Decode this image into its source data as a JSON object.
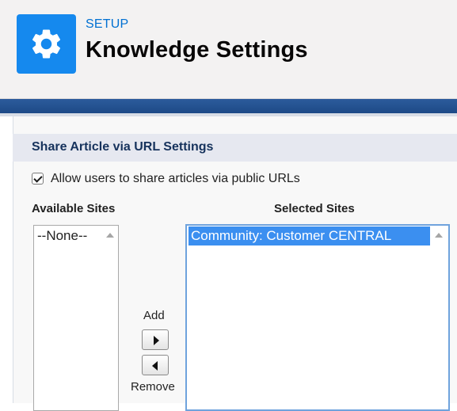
{
  "header": {
    "breadcrumb": "SETUP",
    "title": "Knowledge Settings",
    "icon": "gear-icon",
    "icon_color": "#1589ee"
  },
  "section": {
    "title": "Share Article via URL Settings",
    "allow_public_urls": {
      "label": "Allow users to share articles via public URLs",
      "checked": true
    }
  },
  "sites": {
    "available_label": "Available Sites",
    "selected_label": "Selected Sites",
    "available_options": [
      "--None--"
    ],
    "selected_options": [
      "Community: Customer CENTRAL"
    ],
    "add_label": "Add",
    "remove_label": "Remove"
  }
}
